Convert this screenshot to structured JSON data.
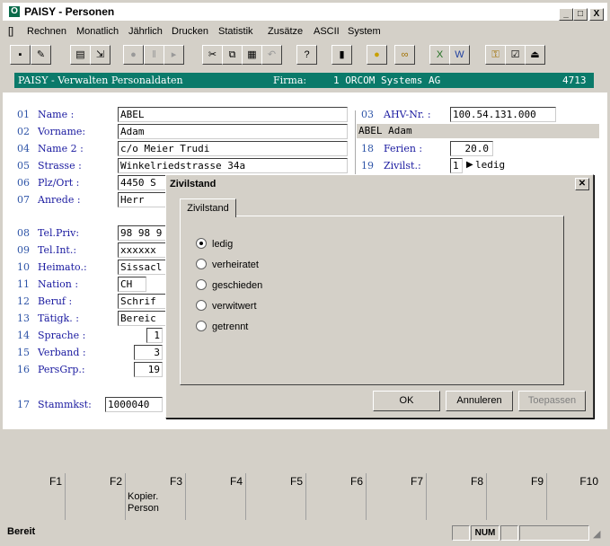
{
  "window": {
    "title": "PAISY - Personen",
    "app_icon": "O",
    "controls": [
      "_",
      "□",
      "X"
    ]
  },
  "menu": [
    "[]",
    "Rechnen",
    "Monatlich",
    "Jährlich",
    "Drucken",
    "Statistik",
    "Zusätze",
    "ASCII",
    "System"
  ],
  "header": {
    "title": "PAISY - Verwalten Personaldaten",
    "firma_label": "Firma:",
    "firma_value": "1 ORCOM Systems AG",
    "code": "4713"
  },
  "form_left": [
    {
      "num": "01",
      "label": "Name :",
      "value": "ABEL"
    },
    {
      "num": "02",
      "label": "Vorname:",
      "value": "Adam"
    },
    {
      "num": "04",
      "label": "Name 2 :",
      "value": "c/o Meier Trudi"
    },
    {
      "num": "05",
      "label": "Strasse :",
      "value": "Winkelriedstrasse 34a"
    },
    {
      "num": "06",
      "label": "Plz/Ort :",
      "value": "4450 S"
    },
    {
      "num": "07",
      "label": "Anrede :",
      "value": "Herr"
    },
    {
      "num": "08",
      "label": "Tel.Priv:",
      "value": "98 98 9"
    },
    {
      "num": "09",
      "label": "Tel.Int.:",
      "value": "xxxxxx"
    },
    {
      "num": "10",
      "label": "Heimato.:",
      "value": "Sissacl"
    },
    {
      "num": "11",
      "label": "Nation :",
      "value": "CH"
    },
    {
      "num": "12",
      "label": "Beruf :",
      "value": "Schrif"
    },
    {
      "num": "13",
      "label": "Tätigk. :",
      "value": "Bereic"
    },
    {
      "num": "14",
      "label": "Sprache :",
      "value": "1"
    },
    {
      "num": "15",
      "label": "Verband :",
      "value": "3"
    },
    {
      "num": "16",
      "label": "PersGrp.:",
      "value": "19"
    },
    {
      "num": "17",
      "label": "Stammkst:",
      "value": "1000040"
    }
  ],
  "form_right": {
    "ahv_num": "03",
    "ahv_label": "AHV-Nr. :",
    "ahv_value": "100.54.131.000",
    "name_display": "ABEL Adam",
    "ferien_num": "18",
    "ferien_label": "Ferien :",
    "ferien_value": "20.0",
    "zivil_num": "19",
    "zivil_label": "Zivilst.:",
    "zivil_code": "1",
    "zivil_text": "ledig"
  },
  "dialog": {
    "title": "Zivilstand",
    "tab": "Zivilstand",
    "options": [
      "ledig",
      "verheiratet",
      "geschieden",
      "verwitwert",
      "getrennt"
    ],
    "selected": "ledig",
    "ok": "OK",
    "cancel": "Annuleren",
    "apply": "Toepassen"
  },
  "fkeys": [
    {
      "key": "F1",
      "text": ""
    },
    {
      "key": "F2",
      "text": ""
    },
    {
      "key": "F3",
      "text": "Kopier.\nPerson"
    },
    {
      "key": "F4",
      "text": ""
    },
    {
      "key": "F5",
      "text": ""
    },
    {
      "key": "F6",
      "text": ""
    },
    {
      "key": "F7",
      "text": ""
    },
    {
      "key": "F8",
      "text": ""
    },
    {
      "key": "F9",
      "text": ""
    },
    {
      "key": "F10",
      "text": ""
    }
  ],
  "status": {
    "text": "Bereit",
    "num": "NUM"
  }
}
